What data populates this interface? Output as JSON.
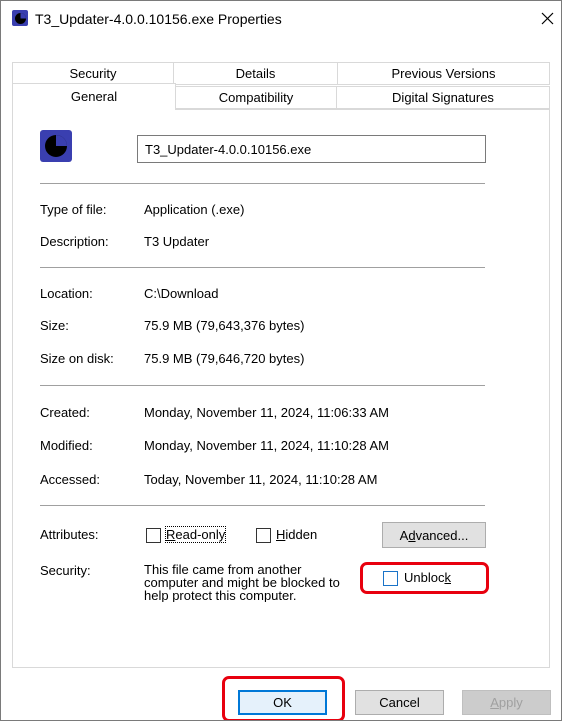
{
  "window": {
    "title": "T3_Updater-4.0.0.10156.exe Properties",
    "close_glyph": "✕"
  },
  "tabs": {
    "row1": [
      "Security",
      "Details",
      "Previous Versions"
    ],
    "row2": [
      "General",
      "Compatibility",
      "Digital Signatures"
    ],
    "selected": "General"
  },
  "general": {
    "file_name": "T3_Updater-4.0.0.10156.exe",
    "type_label": "Type of file:",
    "type_value": "Application (.exe)",
    "description_label": "Description:",
    "description_value": "T3 Updater",
    "location_label": "Location:",
    "location_value": "C:\\Download",
    "size_label": "Size:",
    "size_value": "75.9 MB (79,643,376 bytes)",
    "size_on_disk_label": "Size on disk:",
    "size_on_disk_value": "75.9 MB (79,646,720 bytes)",
    "created_label": "Created:",
    "created_value": "Monday, November 11, 2024, 11:06:33 AM",
    "modified_label": "Modified:",
    "modified_value": "Monday, November 11, 2024, 11:10:28 AM",
    "accessed_label": "Accessed:",
    "accessed_value": "Today, November 11, 2024, 11:10:28 AM",
    "attributes_label": "Attributes:",
    "readonly_label": {
      "first": "R",
      "rest": "ead-only"
    },
    "hidden_label": {
      "first": "H",
      "rest": "idden"
    },
    "advanced_label": {
      "pre": "A",
      "u": "d",
      "post": "vanced..."
    },
    "security_label": "Security:",
    "security_text": [
      "This file came from another",
      "computer and might be blocked to",
      "help protect this computer."
    ],
    "unblock_label": {
      "pre": "Unbloc",
      "u": "k"
    }
  },
  "buttons": {
    "ok": "OK",
    "cancel": "Cancel",
    "apply": {
      "u": "A",
      "rest": "pply"
    }
  },
  "colors": {
    "highlight": "#e8000e",
    "default_button_border": "#0078d7",
    "checkbox_focus": "#1a73c8"
  },
  "icons": {
    "app": "dark-blue-pie-clock-icon",
    "close": "close-icon"
  }
}
